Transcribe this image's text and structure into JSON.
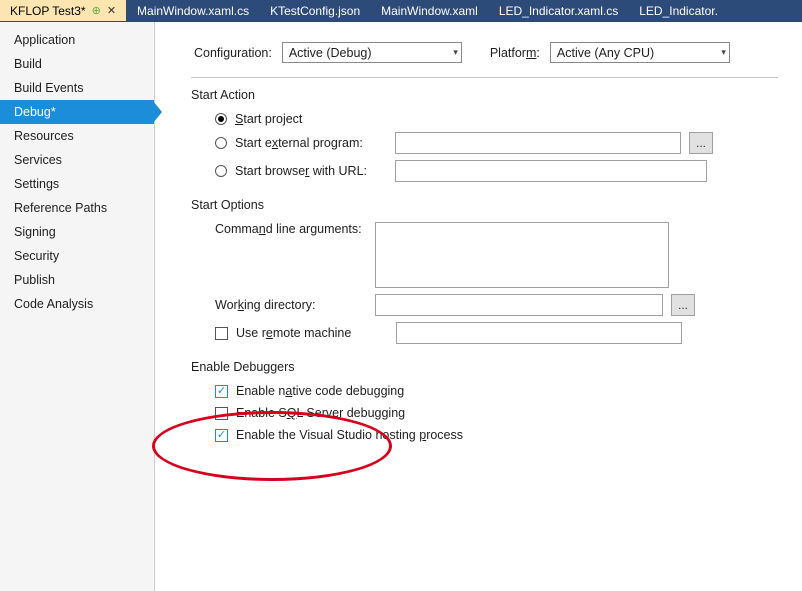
{
  "tabs": [
    {
      "label": "KFLOP Test3*",
      "active": true
    },
    {
      "label": "MainWindow.xaml.cs"
    },
    {
      "label": "KTestConfig.json"
    },
    {
      "label": "MainWindow.xaml"
    },
    {
      "label": "LED_Indicator.xaml.cs"
    },
    {
      "label": "LED_Indicator."
    }
  ],
  "sidebar": {
    "items": [
      {
        "label": "Application"
      },
      {
        "label": "Build"
      },
      {
        "label": "Build Events"
      },
      {
        "label": "Debug*",
        "selected": true
      },
      {
        "label": "Resources"
      },
      {
        "label": "Services"
      },
      {
        "label": "Settings"
      },
      {
        "label": "Reference Paths"
      },
      {
        "label": "Signing"
      },
      {
        "label": "Security"
      },
      {
        "label": "Publish"
      },
      {
        "label": "Code Analysis"
      }
    ]
  },
  "config": {
    "configLabelPrefix": "Confi",
    "configLabelUnder": "g",
    "configLabelSuffix": "uration:",
    "configValue": "Active (Debug)",
    "platformLabelPrefix": "Platfor",
    "platformLabelUnder": "m",
    "platformLabelSuffix": ":",
    "platformValue": "Active (Any CPU)"
  },
  "startAction": {
    "title": "Start Action",
    "optProjectUnder": "S",
    "optProjectRest": "tart project",
    "optExternalPrefix": "Start e",
    "optExternalUnder": "x",
    "optExternalSuffix": "ternal program:",
    "optBrowserPrefix": "Start browse",
    "optBrowserUnder": "r",
    "optBrowserSuffix": " with URL:"
  },
  "startOptions": {
    "title": "Start Options",
    "cmdPrefix": "Comma",
    "cmdUnder": "n",
    "cmdSuffix": "d line arguments:",
    "wdPrefix": "Wor",
    "wdUnder": "k",
    "wdSuffix": "ing directory:",
    "remotePrefix": "Use r",
    "remoteUnder": "e",
    "remoteSuffix": "mote machine"
  },
  "debuggers": {
    "title": "Enable Debuggers",
    "nativePrefix": "Enable n",
    "nativeUnder": "a",
    "nativeSuffix": "tive code debugging",
    "sqlPrefix": "Enable S",
    "sqlUnder": "Q",
    "sqlSuffix": "L Server debugging",
    "hostPrefix": "Enable the Visual Studio hosting ",
    "hostUnder": "p",
    "hostSuffix": "rocess"
  },
  "glyphs": {
    "ellipsis": "...",
    "caret": "▾"
  }
}
